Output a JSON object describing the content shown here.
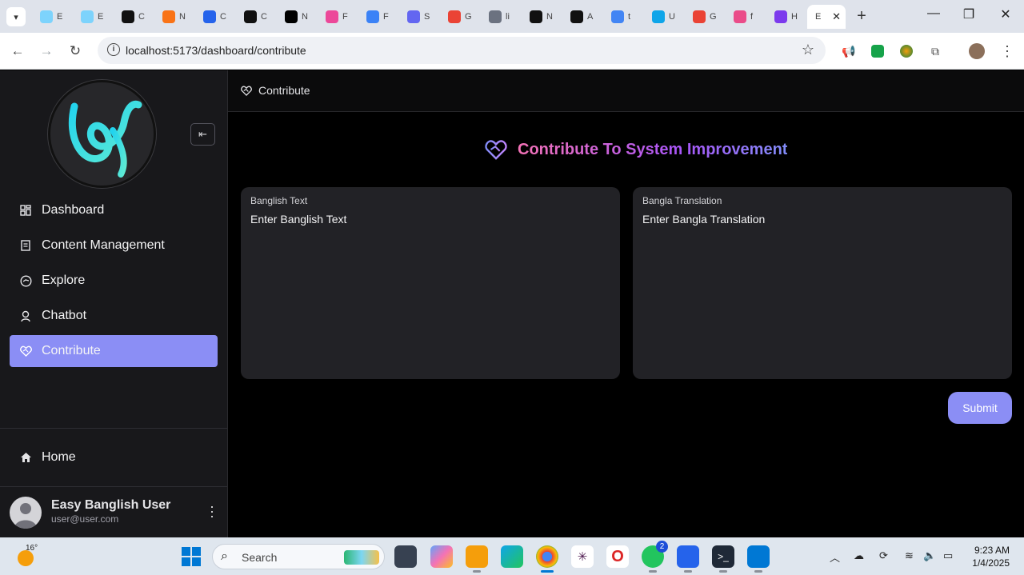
{
  "browser": {
    "tabs": [
      {
        "title": "E",
        "color": "#7dd3fc"
      },
      {
        "title": "E",
        "color": "#7dd3fc"
      },
      {
        "title": "C",
        "color": "#111111"
      },
      {
        "title": "N",
        "color": "#f97316"
      },
      {
        "title": "C",
        "color": "#2563eb"
      },
      {
        "title": "C",
        "color": "#111111"
      },
      {
        "title": "N",
        "color": "#000000"
      },
      {
        "title": "F",
        "color": "#ec4899"
      },
      {
        "title": "F",
        "color": "#3b82f6"
      },
      {
        "title": "S",
        "color": "#6366f1"
      },
      {
        "title": "G",
        "color": "#ea4335"
      },
      {
        "title": "li",
        "color": "#6b7280"
      },
      {
        "title": "N",
        "color": "#111111"
      },
      {
        "title": "A",
        "color": "#111111"
      },
      {
        "title": "t",
        "color": "#4285f4"
      },
      {
        "title": "U",
        "color": "#0ea5e9"
      },
      {
        "title": "G",
        "color": "#ea4335"
      },
      {
        "title": "f",
        "color": "#ea4c89"
      },
      {
        "title": "H",
        "color": "#7c3aed"
      }
    ],
    "active_tab": {
      "title": "E"
    },
    "url": "localhost:5173/dashboard/contribute"
  },
  "sidebar": {
    "collapse_icon": "collapse-left-icon",
    "nav": [
      {
        "label": "Dashboard",
        "icon": "dashboard-icon",
        "active": false
      },
      {
        "label": "Content Management",
        "icon": "content-management-icon",
        "active": false
      },
      {
        "label": "Explore",
        "icon": "explore-icon",
        "active": false
      },
      {
        "label": "Chatbot",
        "icon": "chatbot-icon",
        "active": false
      },
      {
        "label": "Contribute",
        "icon": "contribute-icon",
        "active": true
      }
    ],
    "home": {
      "label": "Home",
      "icon": "home-icon"
    },
    "user": {
      "name": "Easy Banglish User",
      "email": "user@user.com"
    }
  },
  "main": {
    "breadcrumb": "Contribute",
    "title": "Contribute To System Improvement",
    "banglish": {
      "label": "Banglish Text",
      "placeholder": "Enter Banglish Text"
    },
    "bangla": {
      "label": "Bangla Translation",
      "placeholder": "Enter Bangla Translation"
    },
    "submit": "Submit"
  },
  "taskbar": {
    "temperature": "16°",
    "search_placeholder": "Search",
    "whatsapp_badge": "2",
    "time": "9:23 AM",
    "date": "1/4/2025"
  },
  "colors": {
    "accent": "#8b8ef5",
    "sidebar_bg": "#18181b",
    "field_bg": "#222226"
  }
}
